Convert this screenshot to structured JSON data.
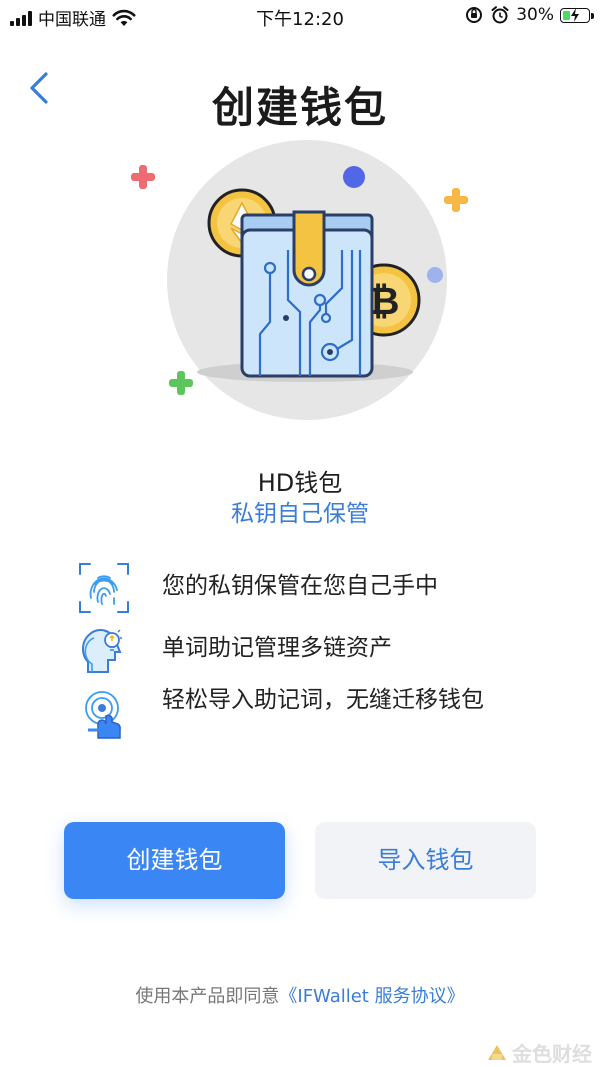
{
  "status_bar": {
    "carrier": "中国联通",
    "time": "下午12:20",
    "battery_percent": "30%",
    "battery_level": 0.3,
    "icons": [
      "signal-icon",
      "wifi-icon",
      "orientation-lock-icon",
      "alarm-icon",
      "battery-icon"
    ]
  },
  "header": {
    "back_icon": "chevron-left-icon",
    "title": "创建钱包"
  },
  "hero": {
    "illustration": "wallet-with-crypto-coins",
    "title": "HD钱包",
    "subtitle": "私钥自己保管"
  },
  "features": [
    {
      "icon": "fingerprint-icon",
      "text": "您的私钥保管在您自己手中"
    },
    {
      "icon": "head-lightbulb-icon",
      "text": "单词助记管理多链资产"
    },
    {
      "icon": "tap-finger-icon",
      "text": "轻松导入助记词，无缝迁移钱包"
    }
  ],
  "buttons": {
    "create_label": "创建钱包",
    "import_label": "导入钱包"
  },
  "agreement": {
    "prefix": "使用本产品即同意",
    "link": "《IFWallet 服务协议》"
  },
  "watermark": {
    "text": "金色财经"
  },
  "colors": {
    "primary": "#3b86f5",
    "link": "#3a7dd8",
    "secondary_button_bg": "#f1f3f6"
  }
}
